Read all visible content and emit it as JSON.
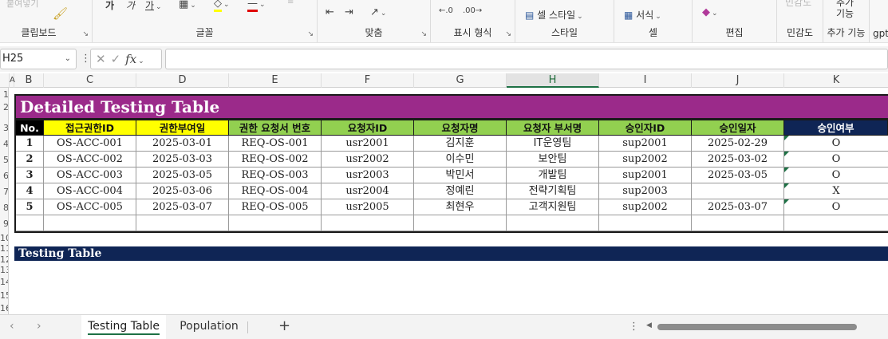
{
  "ribbon": {
    "clipboard": {
      "paste_faded": "붙여넣기",
      "label": "클립보드"
    },
    "font": {
      "btn_increase": "가",
      "btn_decrease": "가",
      "btn_phonetic": "가",
      "label": "글꼴"
    },
    "alignment": {
      "label": "맞춤"
    },
    "number": {
      "label": "표시 형식"
    },
    "styles": {
      "cell_style": "셀 스타일",
      "label": "스타일"
    },
    "cells": {
      "format": "서식",
      "label": "셀"
    },
    "editing": {
      "label": "편집"
    },
    "sensitivity": {
      "faded": "민감도",
      "label": "민감도"
    },
    "addins": {
      "line1": "추가",
      "line2": "기능",
      "label": "추가 기능"
    },
    "gpt": {
      "label": "gpt"
    }
  },
  "formula_bar": {
    "name_box": "H25",
    "fx": "fx",
    "formula": ""
  },
  "grid": {
    "columns": [
      "A",
      "B",
      "C",
      "D",
      "E",
      "F",
      "G",
      "H",
      "I",
      "J",
      "K"
    ],
    "selected_column": "H",
    "rows": [
      "1",
      "2",
      "3",
      "4",
      "5",
      "6",
      "7",
      "8",
      "9",
      "10",
      "11",
      "12",
      "13",
      "14",
      "15",
      "16"
    ]
  },
  "table": {
    "title": "Detailed Testing Table",
    "headers": [
      "No.",
      "접근권한ID",
      "권한부여일",
      "권한 요청서 번호",
      "요청자ID",
      "요청자명",
      "요청자 부서명",
      "승인자ID",
      "승인일자",
      "승인여부"
    ],
    "header_colors": [
      "#000000",
      "#ffff00",
      "#ffff00",
      "#92d050",
      "#92d050",
      "#92d050",
      "#92d050",
      "#92d050",
      "#92d050",
      "#0f2555"
    ],
    "rows": [
      [
        "1",
        "OS-ACC-001",
        "2025-03-01",
        "REQ-OS-001",
        "usr2001",
        "김지훈",
        "IT운영팀",
        "sup2001",
        "2025-02-29",
        "O"
      ],
      [
        "2",
        "OS-ACC-002",
        "2025-03-03",
        "REQ-OS-002",
        "usr2002",
        "이수민",
        "보안팀",
        "sup2002",
        "2025-03-02",
        "O"
      ],
      [
        "3",
        "OS-ACC-003",
        "2025-03-05",
        "REQ-OS-003",
        "usr2003",
        "박민서",
        "개발팀",
        "sup2001",
        "2025-03-05",
        "O"
      ],
      [
        "4",
        "OS-ACC-004",
        "2025-03-06",
        "REQ-OS-004",
        "usr2004",
        "정예린",
        "전략기획팀",
        "sup2003",
        "",
        "X"
      ],
      [
        "5",
        "OS-ACC-005",
        "2025-03-07",
        "REQ-OS-005",
        "usr2005",
        "최현우",
        "고객지원팀",
        "sup2002",
        "2025-03-07",
        "O"
      ],
      [
        "",
        "",
        "",
        "",
        "",
        "",
        "",
        "",
        "",
        ""
      ]
    ],
    "section_title": "Testing Table"
  },
  "sheet_tabs": {
    "tabs": [
      "Testing Table",
      "Population"
    ],
    "active": "Testing Table",
    "add": "+"
  }
}
